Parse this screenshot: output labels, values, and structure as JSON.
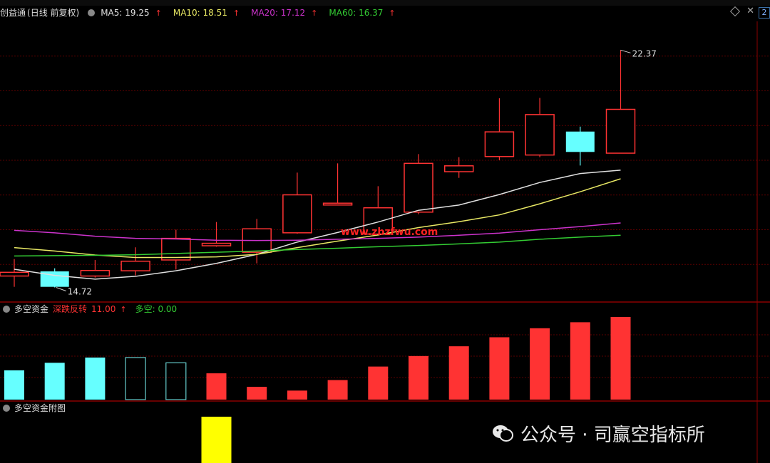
{
  "header": {
    "title": "创益通",
    "period": "(日线 前复权)",
    "ma5": "MA5: 19.25",
    "ma10": "MA10: 18.51",
    "ma20": "MA20: 17.12",
    "ma60": "MA60: 16.37",
    "right_badge": "2"
  },
  "colors": {
    "up": "#ff3333",
    "down": "#66ffff",
    "ma5": "#e0e0e0",
    "ma10": "#e8e864",
    "ma20": "#cc33cc",
    "ma60": "#33cc33",
    "grid": "#5a0000",
    "divider": "#8b0000"
  },
  "annotations": {
    "high_label": "22.37",
    "low_label": "14.72"
  },
  "watermark_site": "www.zbzfwu.com",
  "panel2": {
    "title": "多空资金",
    "signal": "深跌反转",
    "signal_value": "11.00",
    "duokong": "多空: 0.00"
  },
  "panel3": {
    "title": "多空资金附图"
  },
  "wechat_watermark": "公众号 · 司赢空指标所",
  "chart_data": [
    {
      "type": "candlestick",
      "ylim": [
        14.3,
        23.3
      ],
      "candles": [
        {
          "o": 15.05,
          "c": 15.17,
          "h": 15.6,
          "l": 14.7
        },
        {
          "o": 15.2,
          "c": 14.7,
          "h": 15.3,
          "l": 14.68
        },
        {
          "o": 15.05,
          "c": 15.23,
          "h": 15.57,
          "l": 15.0
        },
        {
          "o": 15.22,
          "c": 15.53,
          "h": 15.98,
          "l": 15.07
        },
        {
          "o": 15.57,
          "c": 16.27,
          "h": 16.55,
          "l": 15.26
        },
        {
          "o": 16.03,
          "c": 16.11,
          "h": 16.8,
          "l": 16.0
        },
        {
          "o": 15.82,
          "c": 16.58,
          "h": 16.9,
          "l": 15.46
        },
        {
          "o": 16.45,
          "c": 17.68,
          "h": 18.4,
          "l": 16.42
        },
        {
          "o": 17.35,
          "c": 17.41,
          "h": 18.7,
          "l": 17.35
        },
        {
          "o": 16.41,
          "c": 17.26,
          "h": 17.96,
          "l": 16.36
        },
        {
          "o": 17.12,
          "c": 18.7,
          "h": 19.0,
          "l": 17.05
        },
        {
          "o": 18.43,
          "c": 18.62,
          "h": 18.9,
          "l": 18.23
        },
        {
          "o": 18.92,
          "c": 19.72,
          "h": 20.81,
          "l": 18.8
        },
        {
          "o": 18.97,
          "c": 20.28,
          "h": 20.82,
          "l": 18.9
        },
        {
          "o": 19.73,
          "c": 19.07,
          "h": 19.89,
          "l": 18.63
        },
        {
          "o": 19.03,
          "c": 20.45,
          "h": 22.37,
          "l": 19.03
        }
      ],
      "ma_lines": [
        {
          "name": "MA5",
          "values": [
            15.27,
            15.07,
            14.95,
            15.04,
            15.22,
            15.46,
            15.75,
            16.15,
            16.46,
            16.8,
            17.18,
            17.35,
            17.69,
            18.08,
            18.37,
            18.48
          ]
        },
        {
          "name": "MA10",
          "values": [
            15.97,
            15.86,
            15.73,
            15.65,
            15.65,
            15.67,
            15.75,
            15.97,
            16.18,
            16.38,
            16.62,
            16.81,
            17.03,
            17.39,
            17.78,
            18.2
          ]
        },
        {
          "name": "MA20",
          "values": [
            16.53,
            16.45,
            16.34,
            16.27,
            16.25,
            16.21,
            16.2,
            16.21,
            16.24,
            16.27,
            16.31,
            16.37,
            16.44,
            16.55,
            16.65,
            16.77
          ]
        },
        {
          "name": "MA60",
          "values": [
            15.7,
            15.71,
            15.72,
            15.74,
            15.78,
            15.82,
            15.86,
            15.91,
            15.95,
            16.0,
            16.04,
            16.09,
            16.15,
            16.24,
            16.31,
            16.37
          ]
        }
      ]
    },
    {
      "type": "bar",
      "name": "多空资金",
      "values": [
        3.9,
        4.9,
        5.6,
        5.6,
        4.9,
        3.5,
        1.7,
        1.2,
        2.6,
        4.4,
        5.8,
        7.1,
        8.3,
        9.5,
        10.3,
        11.0
      ],
      "kind": [
        "cyan",
        "cyan",
        "cyan",
        "hollow",
        "hollow",
        "red",
        "red",
        "red",
        "red",
        "red",
        "red",
        "red",
        "red",
        "red",
        "red",
        "red"
      ],
      "ylim": [
        0,
        11.0
      ]
    },
    {
      "type": "bar",
      "name": "多空资金附图",
      "values": [
        0,
        0,
        0,
        0,
        0,
        1,
        0,
        0,
        0,
        0,
        0,
        0,
        0,
        0,
        0,
        0
      ],
      "color": "#ffff00"
    }
  ]
}
